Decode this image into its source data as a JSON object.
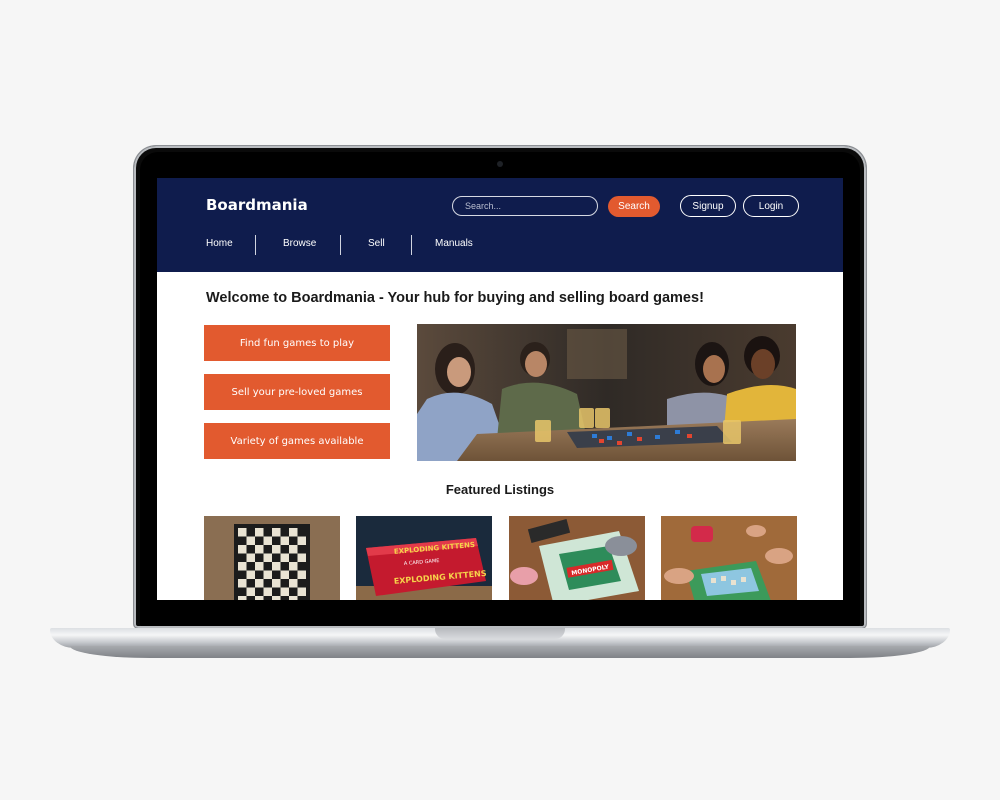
{
  "header": {
    "logo": "Boardmania",
    "search_placeholder": "Search...",
    "search_button": "Search",
    "signup_button": "Signup",
    "login_button": "Login"
  },
  "nav": {
    "items": [
      "Home",
      "Browse",
      "Sell",
      "Manuals"
    ]
  },
  "main": {
    "welcome": "Welcome to Boardmania - Your hub for buying and selling board games!",
    "cta_buttons": [
      "Find fun games to play",
      "Sell your pre-loved games",
      "Variety of games available"
    ],
    "featured_title": "Featured Listings",
    "listing_texts": {
      "exploding_kittens_title": "EXPLODING KITTENS",
      "exploding_kittens_subtitle": "A CARD GAME",
      "monopoly_logo": "MONOPOLY"
    }
  },
  "colors": {
    "header_bg": "#0f1c4d",
    "accent": "#e25a2f"
  }
}
